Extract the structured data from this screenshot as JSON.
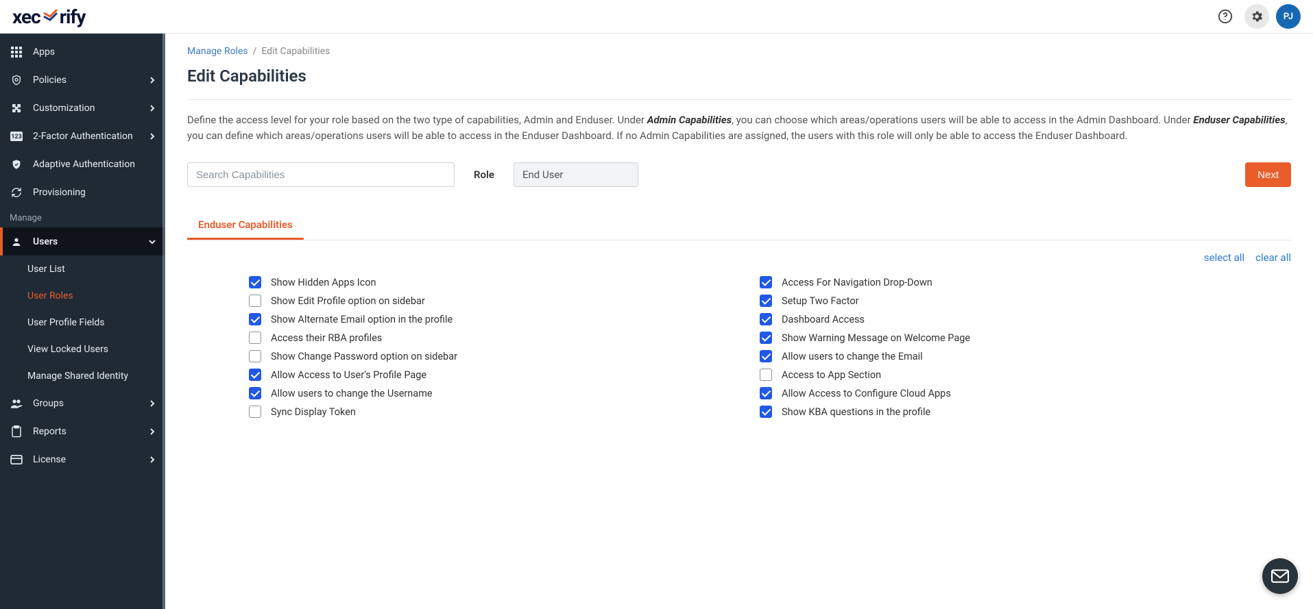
{
  "brand": "xecurify",
  "avatar_initials": "PJ",
  "sidebar": {
    "items": [
      {
        "label": "Apps"
      },
      {
        "label": "Policies",
        "expandable": true
      },
      {
        "label": "Customization",
        "expandable": true
      },
      {
        "label": "2-Factor Authentication",
        "expandable": true
      },
      {
        "label": "Adaptive Authentication"
      },
      {
        "label": "Provisioning"
      }
    ],
    "manage_label": "Manage",
    "users_label": "Users",
    "users_sub": [
      {
        "label": "User List"
      },
      {
        "label": "User Roles",
        "active": true
      },
      {
        "label": "User Profile Fields"
      },
      {
        "label": "View Locked Users"
      },
      {
        "label": "Manage Shared Identity"
      }
    ],
    "groups_label": "Groups",
    "reports_label": "Reports",
    "license_label": "License"
  },
  "breadcrumbs": {
    "parent": "Manage Roles",
    "sep": "/",
    "current": "Edit Capabilities"
  },
  "page_title": "Edit Capabilities",
  "intro": {
    "p1": "Define the access level for your role based on the two type of capabilities, Admin and Enduser. Under ",
    "admin_cap": "Admin Capabilities",
    "p2": ", you can choose which areas/operations users will be able to access in the Admin Dashboard. Under ",
    "enduser_cap": "Enduser Capabilities",
    "p3": ", you can define which areas/operations users will be able to access in the Enduser Dashboard. If no Admin Capabilities are assigned, the users with this role will only be able to access the Enduser Dashboard."
  },
  "search_placeholder": "Search Capabilities",
  "role_label": "Role",
  "role_value": "End User",
  "next_button": "Next",
  "tabs": {
    "enduser": "Enduser Capabilities"
  },
  "bulk": {
    "select_all": "select all",
    "clear_all": "clear all"
  },
  "caps_left": [
    {
      "label": "Show Hidden Apps Icon",
      "checked": true
    },
    {
      "label": "Show Edit Profile option on sidebar",
      "checked": false
    },
    {
      "label": "Show Alternate Email option in the profile",
      "checked": true
    },
    {
      "label": "Access their RBA profiles",
      "checked": false
    },
    {
      "label": "Show Change Password option on sidebar",
      "checked": false
    },
    {
      "label": "Allow Access to User's Profile Page",
      "checked": true
    },
    {
      "label": "Allow users to change the Username",
      "checked": true
    },
    {
      "label": "Sync Display Token",
      "checked": false
    }
  ],
  "caps_right": [
    {
      "label": "Access For Navigation Drop-Down",
      "checked": true
    },
    {
      "label": "Setup Two Factor",
      "checked": true
    },
    {
      "label": "Dashboard Access",
      "checked": true
    },
    {
      "label": "Show Warning Message on Welcome Page",
      "checked": true
    },
    {
      "label": "Allow users to change the Email",
      "checked": true
    },
    {
      "label": "Access to App Section",
      "checked": false
    },
    {
      "label": "Allow Access to Configure Cloud Apps",
      "checked": true
    },
    {
      "label": "Show KBA questions in the profile",
      "checked": true
    }
  ]
}
